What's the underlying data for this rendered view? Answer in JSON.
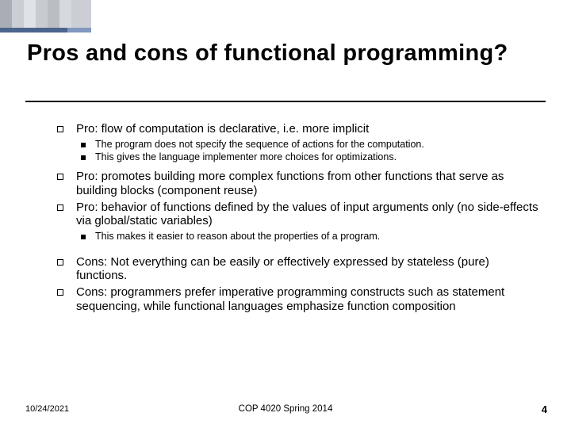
{
  "title": "Pros and cons of  functional programming?",
  "bullets": {
    "b1": "Pro: flow of computation is declarative, i.e. more implicit",
    "b1a": "The program does not specify the sequence of actions for the computation.",
    "b1b": "This gives the language implementer more choices for optimizations.",
    "b2": "Pro: promotes building more complex functions from other functions that serve as building blocks (component reuse)",
    "b3": "Pro: behavior of functions defined by the values of input arguments only (no side-effects via global/static variables)",
    "b3a": "This makes it easier to reason about the properties of a program.",
    "b4": "Cons: Not everything can be easily or effectively expressed by stateless (pure) functions.",
    "b5": "Cons: programmers prefer imperative programming constructs such as statement sequencing, while functional languages emphasize function composition"
  },
  "footer": {
    "date": "10/24/2021",
    "course": "COP 4020 Spring 2014",
    "page": "4"
  }
}
